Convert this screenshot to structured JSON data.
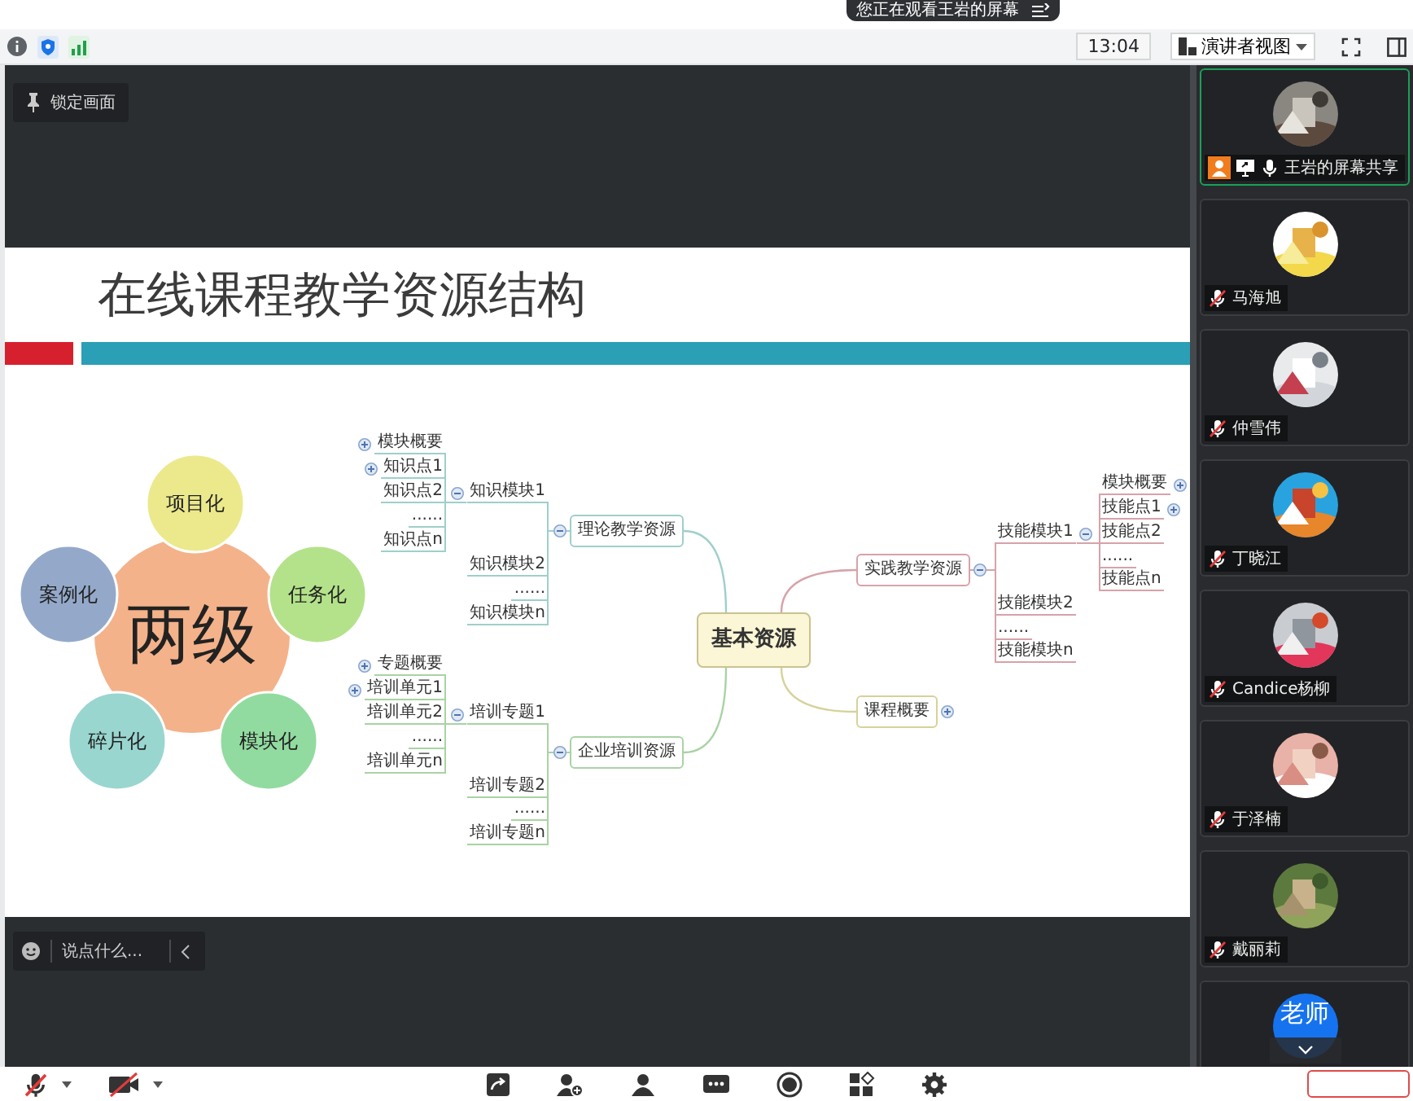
{
  "banner": {
    "text": "您正在观看王岩的屏幕"
  },
  "toolbar": {
    "time": "13:04",
    "view_mode": "演讲者视图"
  },
  "stage": {
    "pin_label": "锁定画面",
    "chat": {
      "placeholder": "说点什么..."
    }
  },
  "slide": {
    "title": "在线课程教学资源结构",
    "venn": {
      "center": "两级",
      "petals": [
        {
          "text": "项目化",
          "color": "#ece98c"
        },
        {
          "text": "任务化",
          "color": "#b4e28a"
        },
        {
          "text": "模块化",
          "color": "#92dba0"
        },
        {
          "text": "碎片化",
          "color": "#99d6d0"
        },
        {
          "text": "案例化",
          "color": "#94a9ca"
        }
      ]
    },
    "mind_map": {
      "center": "基本资源",
      "branches": [
        {
          "text": "理论教学资源",
          "color": "#9fcfca",
          "expanded": true,
          "children": [
            {
              "text": "知识模块1",
              "expanded": true,
              "children": [
                {
                  "text": "模块概要",
                  "expanded": false
                },
                {
                  "text": "知识点1",
                  "expanded": false
                },
                {
                  "text": "知识点2"
                },
                {
                  "text": "......"
                },
                {
                  "text": "知识点n"
                }
              ]
            },
            {
              "text": "知识模块2"
            },
            {
              "text": "......"
            },
            {
              "text": "知识模块n"
            }
          ]
        },
        {
          "text": "企业培训资源",
          "color": "#a9d3a4",
          "expanded": true,
          "children": [
            {
              "text": "培训专题1",
              "expanded": true,
              "children": [
                {
                  "text": "专题概要",
                  "expanded": false
                },
                {
                  "text": "培训单元1",
                  "expanded": false
                },
                {
                  "text": "培训单元2"
                },
                {
                  "text": "......"
                },
                {
                  "text": "培训单元n"
                }
              ]
            },
            {
              "text": "培训专题2"
            },
            {
              "text": "......"
            },
            {
              "text": "培训专题n"
            }
          ]
        },
        {
          "text": "实践教学资源",
          "color": "#d7a2a9",
          "expanded": true,
          "children": [
            {
              "text": "技能模块1",
              "expanded": true,
              "children": [
                {
                  "text": "模块概要",
                  "expanded": false
                },
                {
                  "text": "技能点1",
                  "expanded": false
                },
                {
                  "text": "技能点2"
                },
                {
                  "text": "......"
                },
                {
                  "text": "技能点n"
                }
              ]
            },
            {
              "text": "技能模块2"
            },
            {
              "text": "......"
            },
            {
              "text": "技能模块n"
            }
          ]
        },
        {
          "text": "课程概要",
          "color": "#d6d29a",
          "expanded": false
        }
      ]
    }
  },
  "participants": [
    {
      "name": "王岩的屏幕共享",
      "selected": true,
      "host": true,
      "sharing": true,
      "muted": false
    },
    {
      "name": "马海旭",
      "selected": false,
      "host": false,
      "sharing": false,
      "muted": true
    },
    {
      "name": "仲雪伟",
      "selected": false,
      "host": false,
      "sharing": false,
      "muted": true
    },
    {
      "name": "丁晓江",
      "selected": false,
      "host": false,
      "sharing": false,
      "muted": true
    },
    {
      "name": "Candice杨柳",
      "selected": false,
      "host": false,
      "sharing": false,
      "muted": true
    },
    {
      "name": "于泽楠",
      "selected": false,
      "host": false,
      "sharing": false,
      "muted": true
    },
    {
      "name": "戴丽莉",
      "selected": false,
      "host": false,
      "sharing": false,
      "muted": true
    },
    {
      "selected": false,
      "avatar": {
        "kind": "text",
        "text": "老师"
      }
    }
  ],
  "bottom_bar": {
    "mic_muted": true,
    "camera_off": true
  }
}
